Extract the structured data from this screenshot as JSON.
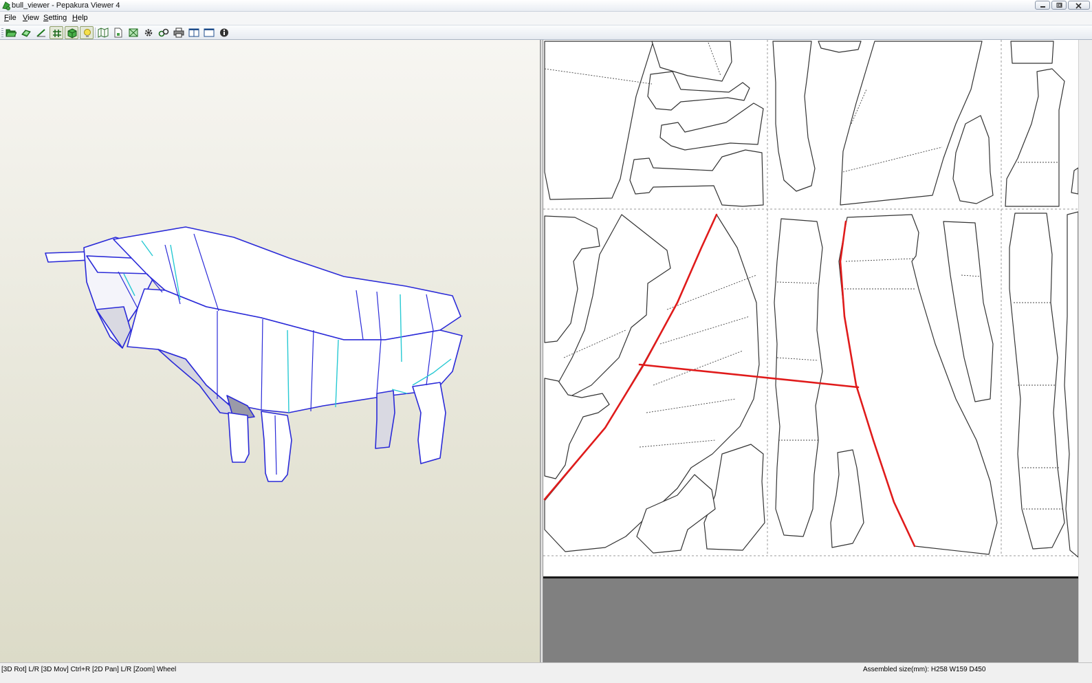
{
  "window": {
    "title": "bull_viewer - Pepakura Viewer 4"
  },
  "menu": {
    "items": [
      {
        "label": "File",
        "accel": "F",
        "rest": "ile"
      },
      {
        "label": "View",
        "accel": "V",
        "rest": "iew"
      },
      {
        "label": "Setting",
        "accel": "S",
        "rest": "etting"
      },
      {
        "label": "Help",
        "accel": "H",
        "rest": "elp"
      }
    ]
  },
  "toolbar": {
    "buttons": [
      {
        "icon": "open-folder-icon",
        "pressed": false
      },
      {
        "icon": "unfold-parts-icon",
        "pressed": false
      },
      {
        "icon": "edge-line-icon",
        "pressed": false
      },
      {
        "icon": "grid-hash-icon",
        "pressed": true
      },
      {
        "icon": "show-texture-cube-icon",
        "pressed": true
      },
      {
        "icon": "light-bulb-icon",
        "pressed": true
      },
      {
        "icon": "flaps-map-icon",
        "pressed": false
      },
      {
        "icon": "page-settings-icon",
        "pressed": false
      },
      {
        "icon": "select-all-icon",
        "pressed": false
      },
      {
        "icon": "gear-icon",
        "pressed": false
      },
      {
        "icon": "link-chain-icon",
        "pressed": false
      },
      {
        "icon": "printer-icon",
        "pressed": false
      },
      {
        "icon": "split-view-icon",
        "pressed": false
      },
      {
        "icon": "single-view-icon",
        "pressed": false
      },
      {
        "icon": "info-icon",
        "pressed": false
      }
    ]
  },
  "colors": {
    "model_edge": "#2a2ad8",
    "model_seam": "#27c9d3",
    "cut_line_highlight": "#e01b1b"
  },
  "status": {
    "hint": "[3D Rot] L/R [3D Mov] Ctrl+R [2D Pan] L/R [Zoom] Wheel",
    "assembled_size": "Assembled size(mm): H258 W159 D450"
  }
}
